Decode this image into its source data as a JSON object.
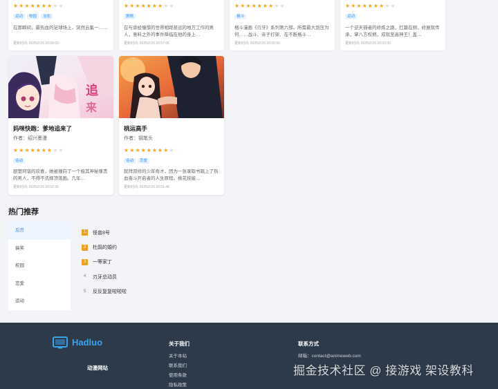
{
  "top_cards": [
    {
      "rating": 4.5,
      "stars": "★★★★★★★",
      "stars_off": "★★",
      "tags": [
        "运动",
        "校园",
        "治愈"
      ],
      "desc": "在那瞬间，最热血的足球场上，突然云集一……",
      "meta": "更新时间: 2025/2/26 20:58:09"
    },
    {
      "rating": 5,
      "stars": "★★★★★★★",
      "stars_off": "★★",
      "tags": [
        "剧情"
      ],
      "desc": "在与曾经憧憬的世界相距甚远的地方工作的男人，意料之外的事件降临在他的身上…",
      "meta": "更新时间: 2025/2/26 20:57:06"
    },
    {
      "rating": 5,
      "stars": "★★★★★★★",
      "stars_off": "★★",
      "tags": [
        "格斗"
      ],
      "desc": "格斗漫画《刃牙》系列第六部。所需最大到压为何……战斗、亲子打架、在不断格斗…",
      "meta": "更新时间: 2025/2/26 20:55:56"
    },
    {
      "rating": 5,
      "stars": "★★★★★★★",
      "stars_off": "★★",
      "tags": [
        "运动"
      ],
      "desc": "一个逆天猫者的修炼之路，扛篇在侧，修展就传承，掌八方权柄，成就至高神王！盖…",
      "meta": "更新时间: 2025/2/26 20:53:30"
    }
  ],
  "cards": [
    {
      "title": "妈咪快跑：爹地追来了",
      "author": "作者：绍兴墨漫",
      "stars": "★★★★★★★",
      "stars_off": "★★",
      "tags": [
        "运动"
      ],
      "desc": "厨楚珂谐的欢喜，她被撞向了一个极其神秘尊贵的男人，不得不洗择顶落画。几年…",
      "meta": "更新时间: 2025/2/26 20:52:36"
    },
    {
      "title": "桃运高手",
      "author": "作者：钢笔头",
      "stars": "★★★★★★★★",
      "stars_off": "★",
      "tags": [
        "运动",
        "恋爱"
      ],
      "desc": "就拜双修的少年奇才，因为一张录取书踏上了热血奋斗开启者的人生原程。桃花技能…",
      "meta": "更新时间: 2025/2/26 20:51:46"
    }
  ],
  "hot": {
    "title": "热门推荐",
    "categories": [
      "后宫",
      "搞笑",
      "校园",
      "恋爱",
      "运动"
    ],
    "ranks": [
      {
        "num": "1",
        "name": "怪兽8号"
      },
      {
        "num": "2",
        "name": "杜鹃的婚约"
      },
      {
        "num": "3",
        "name": "一等家丁"
      },
      {
        "num": "4",
        "name": "刃牙总动员"
      },
      {
        "num": "5",
        "name": "反反复复啦啦啦"
      }
    ]
  },
  "footer": {
    "logo": "Hadluo",
    "site_name": "动漫网站",
    "about_title": "关于我们",
    "about_links": [
      "关于本站",
      "联系我们",
      "使用条款",
      "隐私政策"
    ],
    "contact_title": "联系方式",
    "email": "邮箱：contact@animeweb.com"
  },
  "watermark": "掘金技术社区 @ 接游戏 架设教科",
  "colors": {
    "accent": "#3aa4ef",
    "star": "#f5a623",
    "footer_bg": "#2c3a4a",
    "rank_top": "#f0a020"
  }
}
